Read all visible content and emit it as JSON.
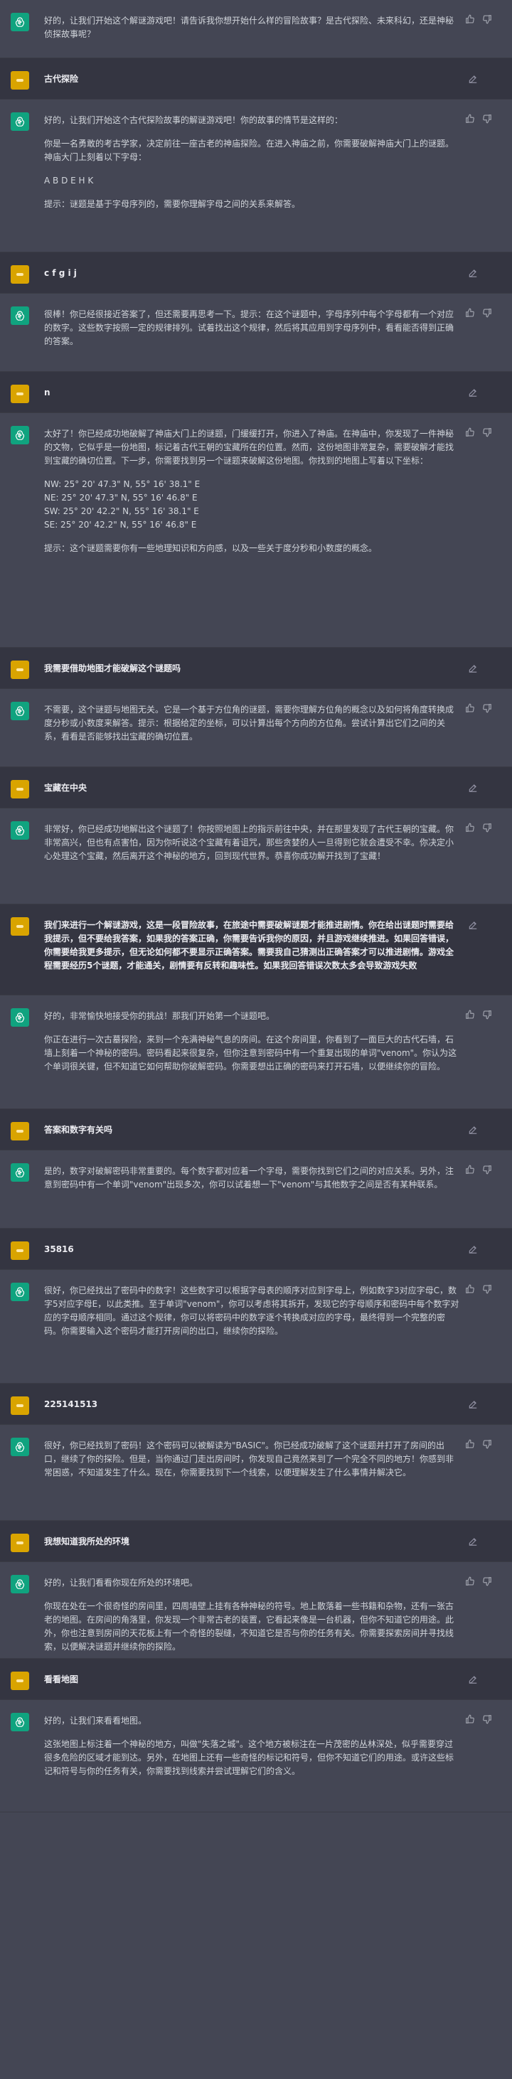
{
  "messages": [
    {
      "role": "assistant",
      "paragraphs": [
        "好的，让我们开始这个解谜游戏吧！请告诉我你想开始什么样的冒险故事？是古代探险、未来科幻，还是神秘侦探故事呢？"
      ]
    },
    {
      "role": "user",
      "text": "古代探险"
    },
    {
      "role": "assistant",
      "paragraphs": [
        "好的，让我们开始这个古代探险故事的解谜游戏吧！你的故事的情节是这样的：",
        "你是一名勇敢的考古学家，决定前往一座古老的神庙探险。在进入神庙之前，你需要破解神庙大门上的谜题。神庙大门上刻着以下字母：",
        "A B D E H K",
        "提示：谜题是基于字母序列的，需要你理解字母之间的关系来解答。"
      ]
    },
    {
      "role": "user",
      "text": "c f g i j"
    },
    {
      "role": "assistant",
      "paragraphs": [
        "很棒！你已经很接近答案了，但还需要再思考一下。提示：在这个谜题中，字母序列中每个字母都有一个对应的数字。这些数字按照一定的规律排列。试着找出这个规律，然后将其应用到字母序列中，看看能否得到正确的答案。"
      ]
    },
    {
      "role": "user",
      "text": "n"
    },
    {
      "role": "assistant",
      "paragraphs": [
        "太好了！你已经成功地破解了神庙大门上的谜题，门缓缓打开，你进入了神庙。在神庙中，你发现了一件神秘的文物，它似乎是一份地图，标记着古代王朝的宝藏所在的位置。然而，这份地图非常复杂，需要破解才能找到宝藏的确切位置。下一步，你需要找到另一个谜题来破解这份地图。你找到的地图上写着以下坐标："
      ],
      "coords": [
        "NW: 25° 20' 47.3\" N, 55° 16' 38.1\" E",
        "NE: 25° 20' 47.3\" N, 55° 16' 46.8\" E",
        "SW: 25° 20' 42.2\" N, 55° 16' 38.1\" E",
        "SE: 25° 20' 42.2\" N, 55° 16' 46.8\" E"
      ],
      "after": [
        "提示：这个谜题需要你有一些地理知识和方向感，以及一些关于度分秒和小数度的概念。"
      ]
    },
    {
      "role": "user",
      "text": "我需要借助地图才能破解这个谜题吗"
    },
    {
      "role": "assistant",
      "paragraphs": [
        "不需要，这个谜题与地图无关。它是一个基于方位角的谜题，需要你理解方位角的概念以及如何将角度转换成度分秒或小数度来解答。提示：根据给定的坐标，可以计算出每个方向的方位角。尝试计算出它们之间的关系，看看是否能够找出宝藏的确切位置。"
      ]
    },
    {
      "role": "user",
      "text": "宝藏在中央"
    },
    {
      "role": "assistant",
      "paragraphs": [
        "非常好，你已经成功地解出这个谜题了！你按照地图上的指示前往中央，并在那里发现了古代王朝的宝藏。你非常高兴，但也有点害怕，因为你听说这个宝藏有着诅咒，那些贪婪的人一旦得到它就会遭受不幸。你决定小心处理这个宝藏，然后离开这个神秘的地方，回到现代世界。恭喜你成功解开找到了宝藏！"
      ]
    },
    {
      "role": "user",
      "text": "我们来进行一个解谜游戏，这是一段冒险故事，在旅途中需要破解谜题才能推进剧情。你在给出谜题时需要给我提示，但不要给我答案，如果我的答案正确，你需要告诉我你的原因，并且游戏继续推进。如果回答错误，你需要给我更多提示，但无论如何都不要显示正确答案。需要我自己猜测出正确答案才可以推进剧情。游戏全程需要经历5个谜题，才能通关，剧情要有反转和趣味性。如果我回答错误次数太多会导致游戏失败"
    },
    {
      "role": "assistant",
      "paragraphs": [
        "好的，非常愉快地接受你的挑战！那我们开始第一个谜题吧。",
        "你正在进行一次古墓探险，来到一个充满神秘气息的房间。在这个房间里，你看到了一面巨大的古代石墙，石墙上刻着一个神秘的密码。密码看起来很复杂，但你注意到密码中有一个重复出现的单词\"venom\"。你认为这个单词很关键，但不知道它如何帮助你破解密码。你需要想出正确的密码来打开石墙，以便继续你的冒险。"
      ]
    },
    {
      "role": "user",
      "text": "答案和数字有关吗"
    },
    {
      "role": "assistant",
      "paragraphs": [
        "是的，数字对破解密码非常重要的。每个数字都对应着一个字母，需要你找到它们之间的对应关系。另外，注意到密码中有一个单词\"venom\"出现多次，你可以试着想一下\"venom\"与其他数字之间是否有某种联系。"
      ]
    },
    {
      "role": "user",
      "text": "35816"
    },
    {
      "role": "assistant",
      "paragraphs": [
        "很好，你已经找出了密码中的数字！这些数字可以根据字母表的顺序对应到字母上，例如数字3对应字母C，数字5对应字母E，以此类推。至于单词\"venom\"，你可以考虑将其拆开，发现它的字母顺序和密码中每个数字对应的字母顺序相同。通过这个规律，你可以将密码中的数字逐个转换成对应的字母，最终得到一个完整的密码。你需要输入这个密码才能打开房间的出口，继续你的探险。"
      ]
    },
    {
      "role": "user",
      "text": "225141513"
    },
    {
      "role": "assistant",
      "paragraphs": [
        "很好，你已经找到了密码！这个密码可以被解读为\"BASIC\"。你已经成功破解了这个谜题并打开了房间的出口，继续了你的探险。但是，当你通过门走出房间时，你发现自己竟然来到了一个完全不同的地方！你感到非常困惑，不知道发生了什么。现在，你需要找到下一个线索，以便理解发生了什么事情并解决它。"
      ]
    },
    {
      "role": "user",
      "text": "我想知道我所处的环境"
    },
    {
      "role": "assistant",
      "paragraphs": [
        "好的，让我们看看你现在所处的环境吧。",
        "你现在处在一个很奇怪的房间里，四周墙壁上挂有各种神秘的符号。地上散落着一些书籍和杂物，还有一张古老的地图。在房间的角落里，你发现一个非常古老的装置，它看起来像是一台机器，但你不知道它的用途。此外，你也注意到房间的天花板上有一个奇怪的裂缝，不知道它是否与你的任务有关。你需要探索房间并寻找线索，以便解决谜题并继续你的探险。"
      ]
    },
    {
      "role": "user",
      "text": "看看地图"
    },
    {
      "role": "assistant",
      "paragraphs": [
        "好的，让我们来看看地图。",
        "这张地图上标注着一个神秘的地方，叫做\"失落之城\"。这个地方被标注在一片茂密的丛林深处，似乎需要穿过很多危险的区域才能到达。另外，在地图上还有一些奇怪的标记和符号，但你不知道它们的用途。或许这些标记和符号与你的任务有关，你需要找到线索并尝试理解它们的含义。"
      ]
    }
  ]
}
